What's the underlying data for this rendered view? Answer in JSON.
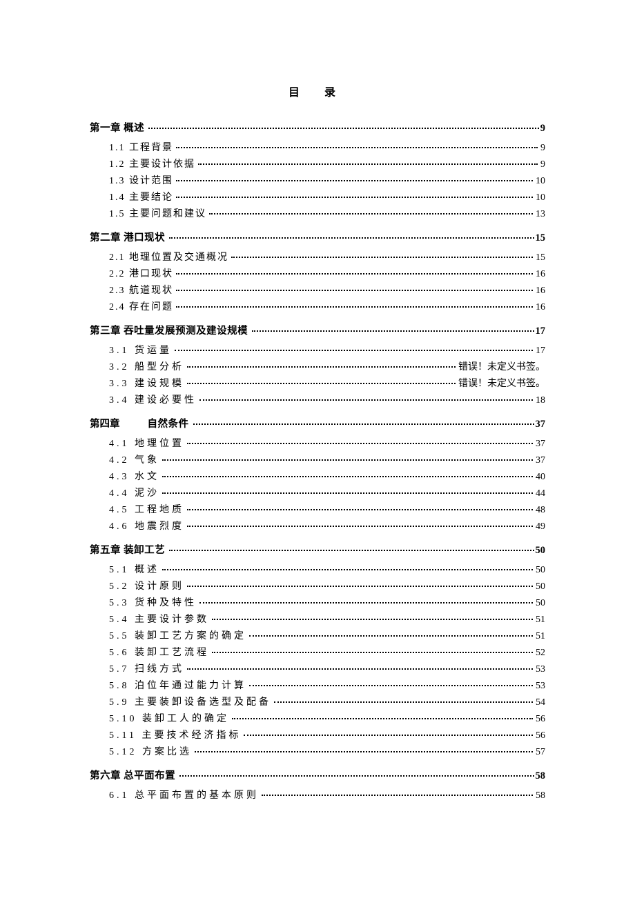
{
  "title": "目  录",
  "chapters": [
    {
      "label": "第一章 概述",
      "page": "9",
      "subs": [
        {
          "label": "1.1 工程背景",
          "page": "9"
        },
        {
          "label": "1.2 主要设计依据",
          "page": "9"
        },
        {
          "label": "1.3 设计范围",
          "page": "10"
        },
        {
          "label": "1.4 主要结论",
          "page": "10"
        },
        {
          "label": "1.5 主要问题和建议",
          "page": "13"
        }
      ]
    },
    {
      "label": "第二章 港口现状",
      "page": "15",
      "subs": [
        {
          "label": "2.1  地理位置及交通概况",
          "page": "15"
        },
        {
          "label": "2.2 港口现状",
          "page": "16"
        },
        {
          "label": "2.3 航道现状",
          "page": "16"
        },
        {
          "label": "2.4 存在问题",
          "page": "16"
        }
      ]
    },
    {
      "label": "第三章 吞吐量发展预测及建设规模",
      "page": "17",
      "subs": [
        {
          "label": "3.1  货运量",
          "page": "17",
          "wide": true
        },
        {
          "label": "3.2  船型分析",
          "page": "错误！未定义书签。",
          "wide": true
        },
        {
          "label": "3.3  建设规模",
          "page": "错误！未定义书签。",
          "wide": true
        },
        {
          "label": "3.4  建设必要性",
          "page": "18",
          "wide": true
        }
      ]
    },
    {
      "label": "第四章",
      "label2": "自然条件",
      "page": "37",
      "special": true,
      "subs": [
        {
          "label": "4.1 地理位置",
          "page": "37",
          "wide": true
        },
        {
          "label": "4.2 气象",
          "page": "37",
          "wide": true
        },
        {
          "label": "4.3 水文",
          "page": "40",
          "wide": true
        },
        {
          "label": "4.4 泥沙",
          "page": "44",
          "wide": true
        },
        {
          "label": "4.5 工程地质",
          "page": "48",
          "wide": true
        },
        {
          "label": "4.6 地震烈度",
          "page": "49",
          "wide": true
        }
      ]
    },
    {
      "label": "第五章 装卸工艺",
      "page": "50",
      "subs": [
        {
          "label": "5.1 概述",
          "page": "50",
          "wide": true
        },
        {
          "label": "5.2 设计原则",
          "page": "50",
          "wide": true
        },
        {
          "label": "5.3 货种及特性",
          "page": "50",
          "wide": true
        },
        {
          "label": "5.4 主要设计参数",
          "page": "51",
          "wide": true
        },
        {
          "label": "5.5 装卸工艺方案的确定",
          "page": "51",
          "wide": true
        },
        {
          "label": "5.6 装卸工艺流程",
          "page": "52",
          "wide": true
        },
        {
          "label": "5.7 扫线方式",
          "page": "53",
          "wide": true
        },
        {
          "label": "5.8 泊位年通过能力计算",
          "page": "53",
          "wide": true
        },
        {
          "label": "5.9 主要装卸设备选型及配备",
          "page": "54",
          "wide": true
        },
        {
          "label": "5.10 装卸工人的确定",
          "page": "56",
          "wide": true
        },
        {
          "label": "5.11 主要技术经济指标",
          "page": "56",
          "wide": true
        },
        {
          "label": "5.12 方案比选",
          "page": "57",
          "wide": true
        }
      ]
    },
    {
      "label": "第六章 总平面布置",
      "page": "58",
      "subs": [
        {
          "label": "6.1 总平面布置的基本原则",
          "page": "58",
          "wide": true
        }
      ]
    }
  ]
}
